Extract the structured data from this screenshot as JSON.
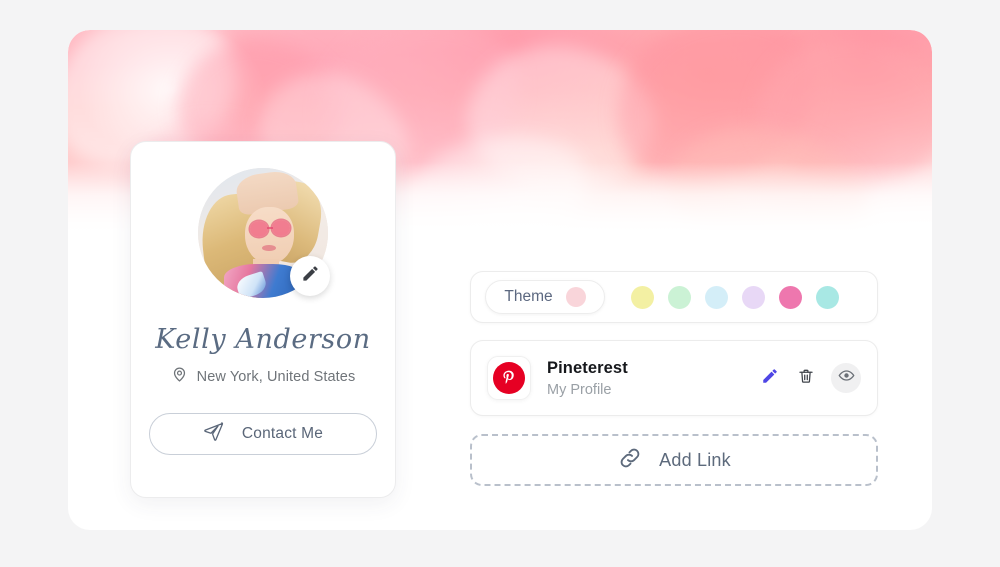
{
  "profile": {
    "name": "Kelly Anderson",
    "location": "New York, United States",
    "location_icon": "map-pin-icon",
    "avatar_edit_icon": "pencil-icon",
    "contact_button_label": "Contact Me",
    "contact_button_icon": "send-plane-icon"
  },
  "theme": {
    "pill_label": "Theme",
    "selected_color": "#F9D5DA",
    "swatches": [
      {
        "name": "yellow",
        "color": "#F3F0A3"
      },
      {
        "name": "mint",
        "color": "#CBF2D5"
      },
      {
        "name": "sky",
        "color": "#D4EEF8"
      },
      {
        "name": "lavender",
        "color": "#E8D8F6"
      },
      {
        "name": "pink",
        "color": "#EE77AE"
      },
      {
        "name": "turquoise",
        "color": "#A8E8E4"
      }
    ]
  },
  "links": [
    {
      "title": "Pineterest",
      "subtitle": "My Profile",
      "logo": "pinterest-icon",
      "logo_color": "#E60023",
      "logo_letter": "P",
      "actions": [
        {
          "name": "edit-link-button",
          "icon": "pencil-icon",
          "color": "#4F46E5"
        },
        {
          "name": "delete-link-button",
          "icon": "trash-icon",
          "color": "#3F434A"
        },
        {
          "name": "toggle-visibility-button",
          "icon": "eye-icon",
          "color": "#6B7077"
        }
      ]
    }
  ],
  "add_link": {
    "label": "Add Link",
    "icon": "chain-link-icon"
  },
  "colors": {
    "page_background": "#F4F4F5",
    "card_background": "#FFFFFF",
    "banner_accent": "#FFAEB8",
    "text_primary": "#16181C",
    "text_muted": "#9AA0A6"
  }
}
